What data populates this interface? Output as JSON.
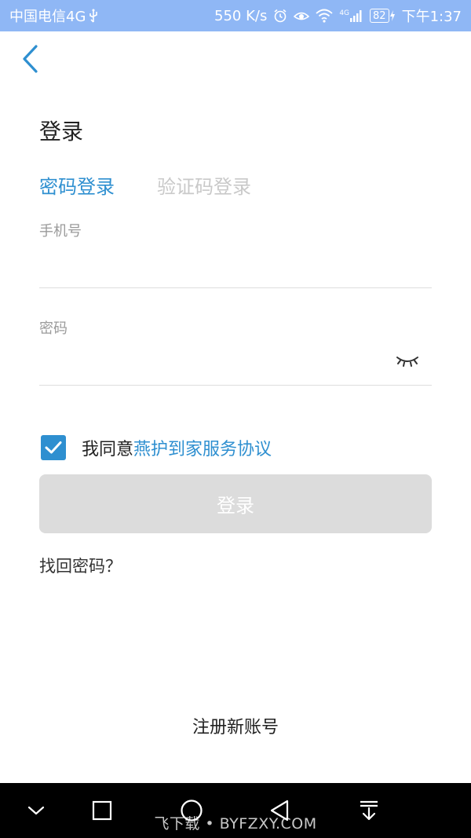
{
  "status_bar": {
    "carrier": "中国电信4G",
    "usb_icon": "usb-icon",
    "speed": "550 K/s",
    "alarm_icon": "alarm-icon",
    "eye_icon": "eye-comfort-icon",
    "wifi_icon": "wifi-icon",
    "signal_label": "4G",
    "battery": "82",
    "time": "下午1:37"
  },
  "header": {
    "back_icon": "chevron-left-icon",
    "title": "登录"
  },
  "tabs": {
    "password_login": "密码登录",
    "code_login": "验证码登录",
    "active": "password_login"
  },
  "form": {
    "phone_label": "手机号",
    "phone_value": "",
    "password_label": "密码",
    "password_value": "",
    "password_toggle_icon": "eye-closed-icon"
  },
  "agreement": {
    "checked": true,
    "prefix": "我同意",
    "link_text": "燕护到家服务协议"
  },
  "actions": {
    "login_label": "登录",
    "forgot_password": "找回密码？",
    "register": "注册新账号"
  },
  "nav_bar": {
    "icons": [
      "chevron-down-icon",
      "square-icon",
      "circle-icon",
      "triangle-back-icon",
      "download-icon"
    ]
  },
  "watermark": "飞下载 • BYFZXY.COM",
  "colors": {
    "status_bar": "#8fb7f5",
    "accent": "#2e8fd0",
    "inactive_tab": "#c9c9c9",
    "button_disabled": "#dcdcdc",
    "nav_bar": "#000000"
  }
}
